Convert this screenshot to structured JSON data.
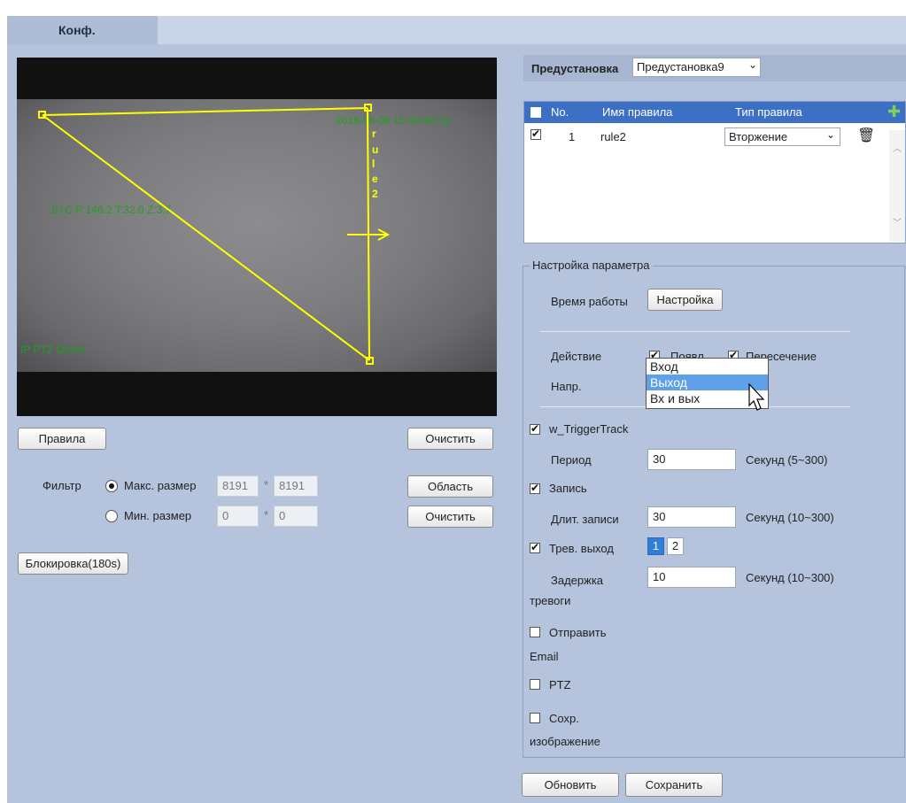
{
  "tab": {
    "label": "Конф."
  },
  "video": {
    "timestamp": "2018-06-08 15:49:46 Ср",
    "ptz_info": "BTC P:146.2 T:32.0 Z:3.7",
    "camera_name": "IP PTZ Dome",
    "rule_label": [
      "r",
      "u",
      "l",
      "e",
      "2"
    ]
  },
  "left": {
    "rules_button": "Правила",
    "clear_button_1": "Очистить",
    "filter_label": "Фильтр",
    "max_size_label": "Макс. размер",
    "max_w": "8191",
    "max_h": "8191",
    "min_size_label": "Мин. размер",
    "min_w": "0",
    "min_h": "0",
    "times": "*",
    "area_button": "Область",
    "clear_button_2": "Очистить",
    "block_button": "Блокировка(180s)"
  },
  "preset": {
    "label": "Предустановка",
    "value": "Предустановка9"
  },
  "rules_table": {
    "headers": {
      "no": "No.",
      "name": "Имя правила",
      "type": "Тип правила",
      "add_icon": "plus-icon"
    },
    "rows": [
      {
        "no": "1",
        "name": "rule2",
        "type": "Вторжение"
      }
    ]
  },
  "params": {
    "legend": "Настройка параметра",
    "work_time_label": "Время работы",
    "setup_button": "Настройка",
    "action_label": "Действие",
    "action_appear": "Появл",
    "action_cross": "Пересечение",
    "direction_label": "Напр.",
    "direction_options": [
      "Вход",
      "Выход",
      "Вх и вых"
    ],
    "direction_highlight": "Выход",
    "trigger_track": "w_TriggerTrack",
    "period_label": "Период",
    "period_value": "30",
    "period_unit": "Секунд (5~300)",
    "record_label": "Запись",
    "record_len_label": "Длит. записи",
    "record_len_value": "30",
    "record_len_unit": "Секунд (10~300)",
    "alarm_out_label": "Трев. выход",
    "alarm_out_1": "1",
    "alarm_out_2": "2",
    "alarm_delay_label_1": "Задержка",
    "alarm_delay_label_2": "тревоги",
    "alarm_delay_value": "10",
    "alarm_delay_unit": "Секунд (10~300)",
    "email_label_1": "Отправить",
    "email_label_2": "Email",
    "ptz_label": "PTZ",
    "snapshot_label_1": "Сохр.",
    "snapshot_label_2": "изображение"
  },
  "footer": {
    "refresh_button": "Обновить",
    "save_button": "Сохранить"
  },
  "colors": {
    "accent": "#3c70c4",
    "panel": "#b5c3dd",
    "osd_text": "#1ea01e",
    "rule_line": "#ffff00"
  }
}
